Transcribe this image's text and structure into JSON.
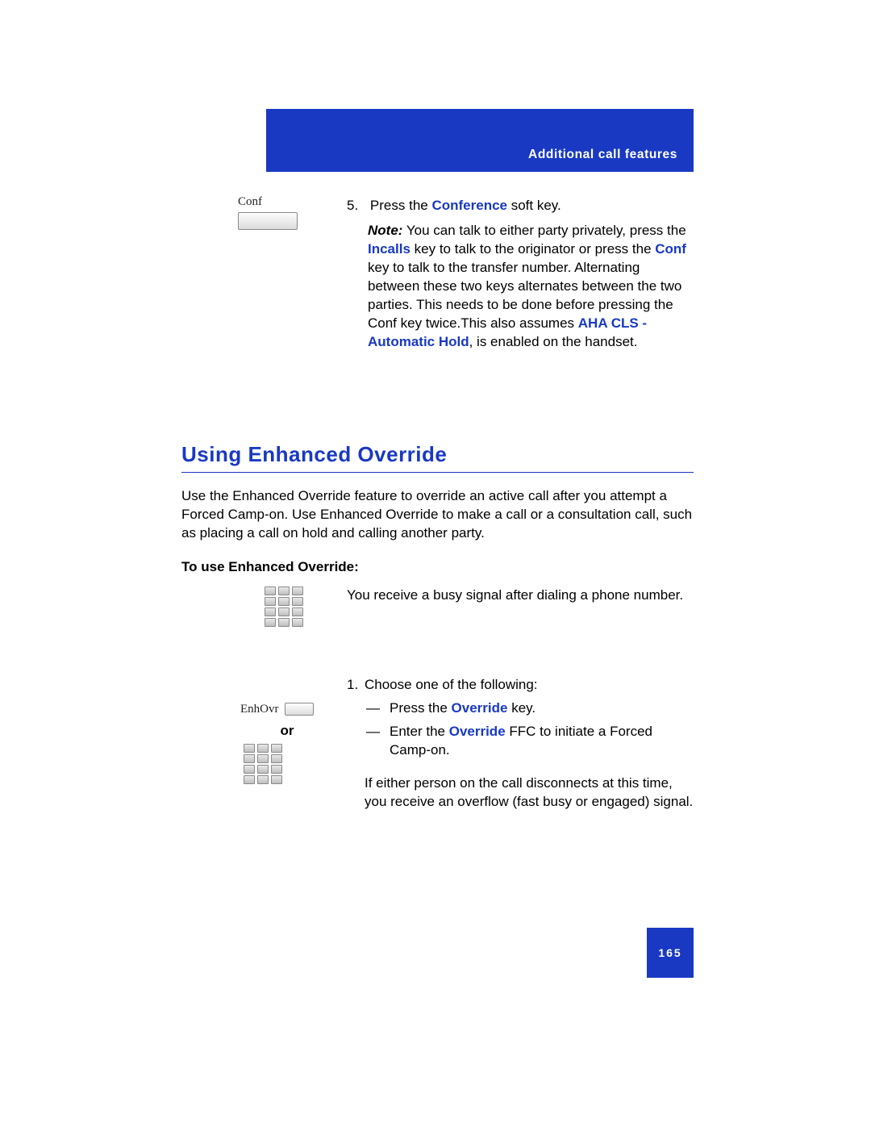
{
  "header": {
    "title": "Additional call features"
  },
  "step5": {
    "softkey_label": "Conf",
    "line_prefix": "5.",
    "line_text_1": "Press the ",
    "line_bold_1": "Conference",
    "line_text_2": " soft key.",
    "note_prefix": "Note:",
    "note_p1": " You can talk to either party privately, press the ",
    "note_bold_incalls": "Incalls",
    "note_p2": " key to talk to the originator or press the ",
    "note_bold_conf": "Conf",
    "note_p3": " key to talk to the transfer number. Alternating between these two keys alternates between the two parties. This needs to be done before pressing the Conf key twice.This also assumes ",
    "note_bold_aha": "AHA CLS - Automatic Hold",
    "note_p4": ", is enabled on the handset."
  },
  "section": {
    "heading": "Using Enhanced Override",
    "intro": "Use the Enhanced Override feature to override an active call after you attempt a Forced Camp-on. Use Enhanced Override to make a call or a consultation call, such as placing a call on hold and calling another party.",
    "sub_heading": "To use Enhanced Override:"
  },
  "busy": {
    "text": "You receive a busy signal after dialing a phone number."
  },
  "override": {
    "softkey_label": "EnhOvr",
    "or_label": "or",
    "step_num": "1.",
    "step_text": "Choose one of the following:",
    "opt1_pre": "Press the ",
    "opt1_bold": "Override",
    "opt1_post": " key.",
    "opt2_pre": "Enter the ",
    "opt2_bold": "Override",
    "opt2_post": " FFC to initiate a Forced Camp-on.",
    "tail": "If either person on the call disconnects at this time, you receive an overflow (fast busy or engaged) signal."
  },
  "page_number": "165"
}
